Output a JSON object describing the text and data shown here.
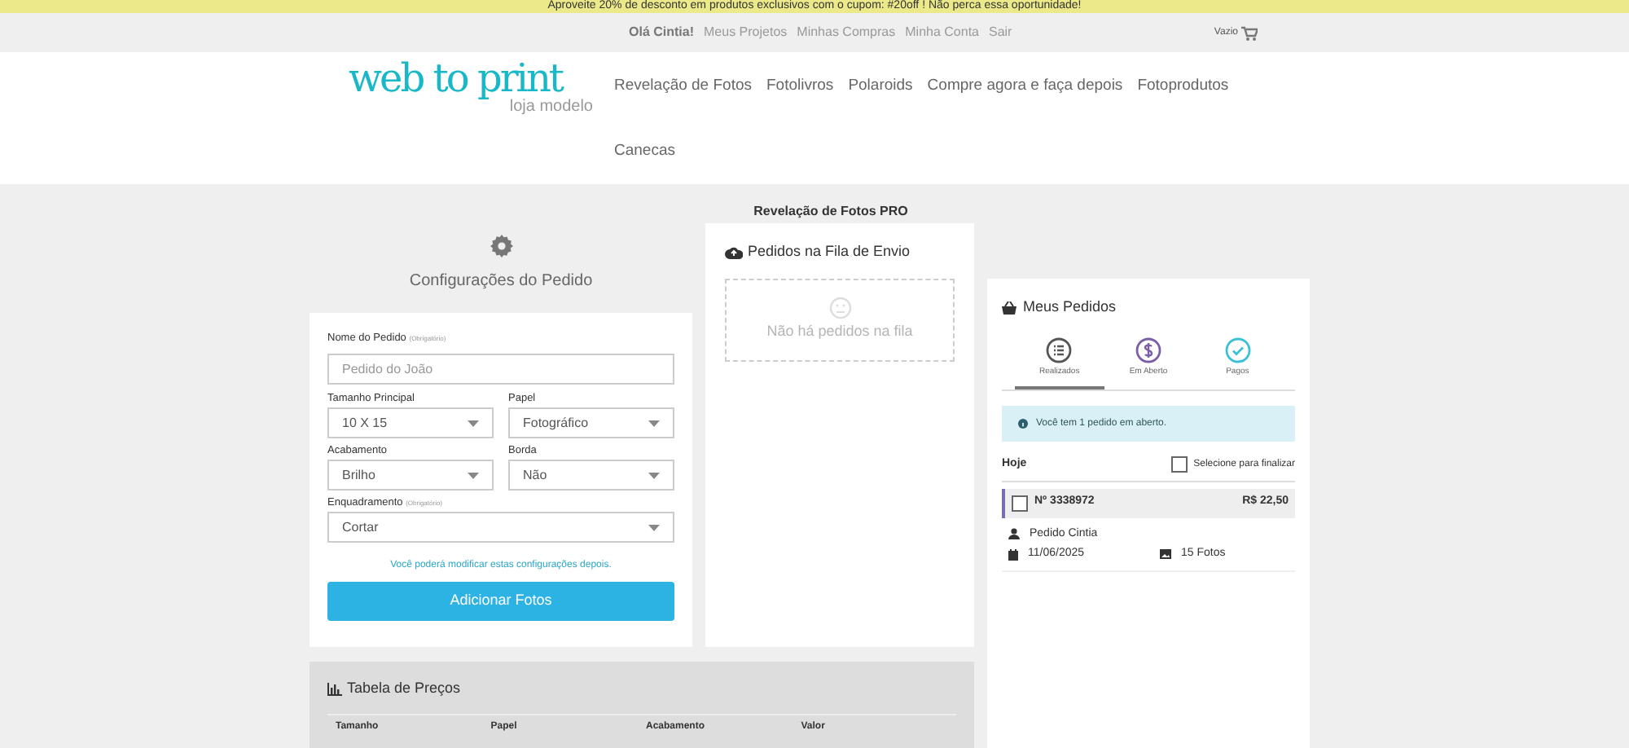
{
  "promo_banner": "Aproveite 20% de desconto em produtos exclusivos com o cupom: #20off ! Não perca essa oportunidade!",
  "user_bar": {
    "greeting": "Olá Cintia!",
    "links": [
      "Meus Projetos",
      "Minhas Compras",
      "Minha Conta",
      "Sair"
    ],
    "cart_label": "Vazio"
  },
  "logo": {
    "title": "web to print",
    "subtitle": "loja modelo"
  },
  "nav": [
    "Revelação de Fotos",
    "Fotolivros",
    "Polaroids",
    "Compre agora e faça depois",
    "Fotoprodutos",
    "Canecas"
  ],
  "page_title": "Revelação de Fotos PRO",
  "config": {
    "title": "Configurações do Pedido",
    "fields": [
      {
        "kind": "text",
        "label": "Nome do Pedido",
        "note": "(Obrigatório)",
        "placeholder": "Pedido do João"
      },
      {
        "kind": "select",
        "label": "Tamanho Principal",
        "value": "10 X 15"
      },
      {
        "kind": "select",
        "label": "Papel",
        "value": "Fotográfico"
      },
      {
        "kind": "select",
        "label": "Acabamento",
        "value": "Brilho"
      },
      {
        "kind": "select",
        "label": "Borda",
        "value": "Não"
      },
      {
        "kind": "select",
        "label": "Enquadramento",
        "note": "(Obrigatório)",
        "value": "Cortar"
      }
    ],
    "hint": "Você poderá modificar estas configurações depois.",
    "button": "Adicionar Fotos"
  },
  "queue": {
    "title": "Pedidos na Fila de Envio",
    "empty": "Não há pedidos na fila"
  },
  "orders": {
    "title": "Meus Pedidos",
    "tabs": [
      {
        "label": "Realizados",
        "kind": "list",
        "color": "#555555",
        "selected": true
      },
      {
        "label": "Em Aberto",
        "kind": "dollar",
        "color": "#7b5ea7",
        "selected": false
      },
      {
        "label": "Pagos",
        "kind": "check",
        "color": "#3cc0d8",
        "selected": false
      }
    ],
    "alert": "Você tem 1 pedido em aberto.",
    "group": {
      "label": "Hoje",
      "select_all": "Selecione para finalizar",
      "checked": false
    },
    "items": [
      {
        "number": "Nº 3338972",
        "price": "R$ 22,50",
        "name": "Pedido Cintia",
        "date": "11/06/2025",
        "photos": "15 Fotos",
        "checked": false
      }
    ]
  },
  "price_table": {
    "title": "Tabela de Preços",
    "columns": [
      "Tamanho",
      "Papel",
      "Acabamento",
      "Valor"
    ]
  }
}
